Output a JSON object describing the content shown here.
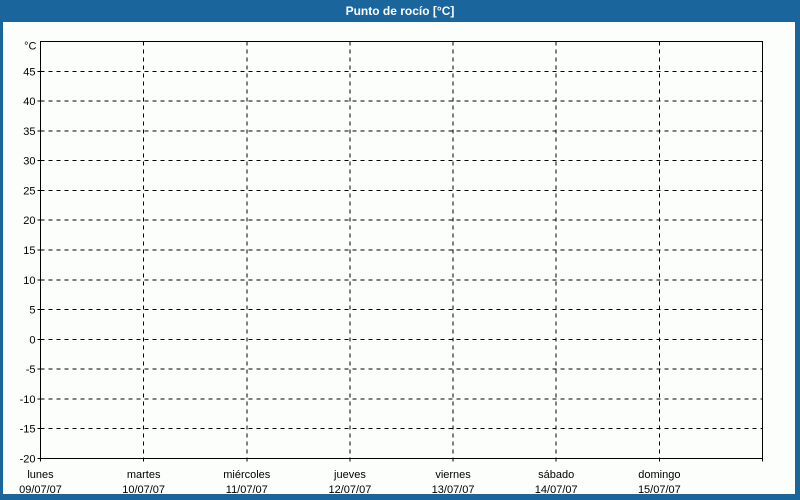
{
  "window": {
    "title": "Punto de rocío [°C]"
  },
  "colors": {
    "frame_blue": "#1a669c",
    "title_text": "#ffffff",
    "chart_bg": "#fbfefb",
    "axis_color": "#000000",
    "grid_color": "#000000",
    "label_color": "#000000"
  },
  "chart_data": {
    "type": "line",
    "title": "Punto de rocío [°C]",
    "ylabel": "°C",
    "xlabel": "",
    "ylim": [
      -20,
      50
    ],
    "y_tick_values": [
      45,
      40,
      35,
      30,
      25,
      20,
      15,
      10,
      5,
      0,
      -5,
      -10,
      -15,
      -20
    ],
    "x_categories": [
      {
        "day": "lunes",
        "date": "09/07/07"
      },
      {
        "day": "martes",
        "date": "10/07/07"
      },
      {
        "day": "miércoles",
        "date": "11/07/07"
      },
      {
        "day": "jueves",
        "date": "12/07/07"
      },
      {
        "day": "viernes",
        "date": "13/07/07"
      },
      {
        "day": "sábado",
        "date": "14/07/07"
      },
      {
        "day": "domingo",
        "date": "15/07/07"
      }
    ],
    "grid": {
      "style": "dashed",
      "horizontal": true,
      "vertical": true
    },
    "legend": null,
    "series": []
  }
}
